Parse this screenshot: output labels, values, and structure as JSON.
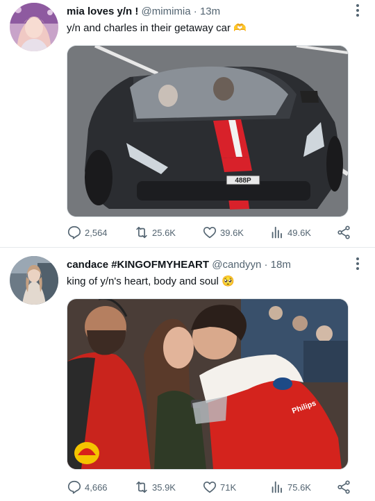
{
  "tweets": [
    {
      "display_name": "mia loves y/n !",
      "handle": "@mimimia",
      "separator": "·",
      "time": "13m",
      "text": "y/n and charles in their getaway car 🫶",
      "image_alt": "black sports car with red and white stripe",
      "plate": "488P",
      "replies": "2,564",
      "retweets": "25.6K",
      "likes": "39.6K",
      "views": "49.6K"
    },
    {
      "display_name": "candace #KINGOFMYHEART",
      "handle": "@candyyn",
      "separator": "·",
      "time": "18m",
      "text": "king of y/n's heart, body and soul 🥺",
      "image_alt": "couple kissing in crowd, man in red racing suit",
      "replies": "4,666",
      "retweets": "35.9K",
      "likes": "71K",
      "views": "75.6K"
    }
  ],
  "icons": [
    "reply-icon",
    "retweet-icon",
    "like-icon",
    "views-icon",
    "share-icon",
    "more-options-icon"
  ],
  "colors": {
    "text": "#0f1419",
    "secondary": "#536471",
    "divider": "#e6e9eb",
    "car_red": "#d8212a"
  }
}
